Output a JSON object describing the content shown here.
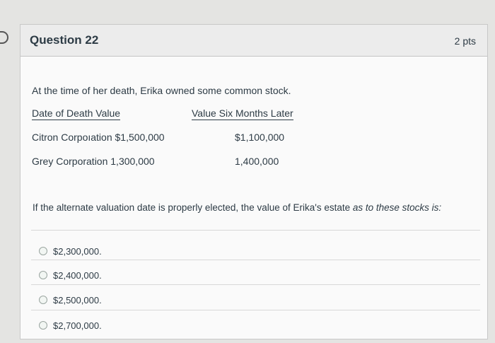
{
  "question": {
    "title": "Question 22",
    "points": "2 pts",
    "stem": "At the time of her death, Erika owned some common stock.",
    "table": {
      "headers": [
        "Date of Death Value",
        "Value Six Months Later"
      ],
      "rows": [
        {
          "left": "Citron Corpoıation $1,500,000",
          "right": "$1,100,000"
        },
        {
          "left": "Grey Corporation 1,300,000",
          "right": "1,400,000"
        }
      ]
    },
    "prompt_main": "If the alternate valuation date is properly elected, the value of Erika's estate ",
    "prompt_italic": "as to these stocks is:",
    "answers": [
      "$2,300,000.",
      "$2,400,000.",
      "$2,500,000.",
      "$2,700,000."
    ]
  }
}
